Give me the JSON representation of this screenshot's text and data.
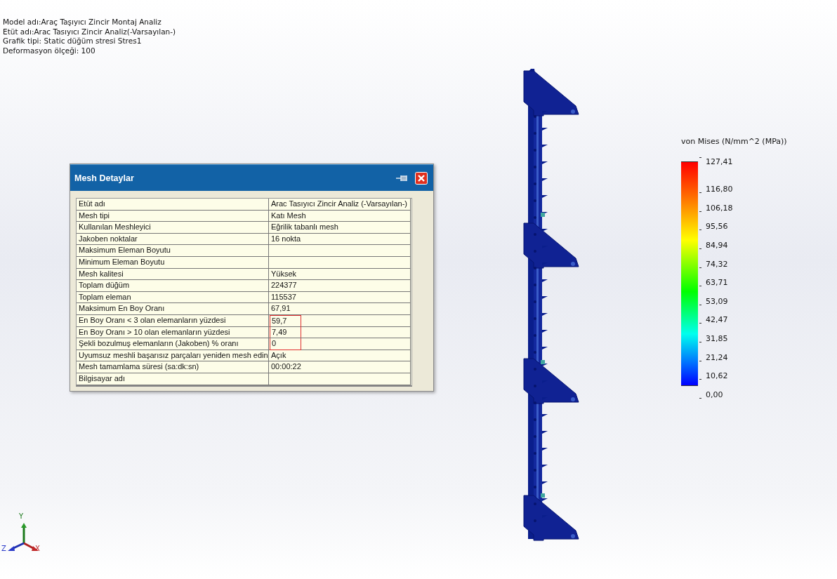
{
  "info_lines": [
    "Model adı:Araç Taşıyıcı Zincir Montaj Analiz",
    "Etüt adı:Arac Tasıyıcı Zincir Analiz(-Varsayılan-)",
    "Grafik tipi: Static düğüm stresi Stres1",
    "Deformasyon ölçeği: 100"
  ],
  "dialog": {
    "title": "Mesh Detaylar",
    "rows": [
      {
        "label": "Etüt adı",
        "value": "Arac Tasıyıcı Zincir Analiz (-Varsayılan-)",
        "highlighted": false
      },
      {
        "label": "Mesh tipi",
        "value": "Katı Mesh",
        "highlighted": false
      },
      {
        "label": "Kullanılan Meshleyici",
        "value": "Eğrilik tabanlı mesh",
        "highlighted": false
      },
      {
        "label": "Jakoben noktalar",
        "value": "16 nokta",
        "highlighted": false
      },
      {
        "label": "Maksimum Eleman Boyutu",
        "highlighted": false
      },
      {
        "label": "Minimum Eleman Boyutu",
        "highlighted": false
      },
      {
        "label": "Mesh kalitesi",
        "value": "Yüksek",
        "highlighted": false
      },
      {
        "label": "Toplam düğüm",
        "value": "224377",
        "highlighted": false
      },
      {
        "label": "Toplam eleman",
        "value": "115537",
        "highlighted": false
      },
      {
        "label": "Maksimum En Boy Oranı",
        "value": "67,91",
        "highlighted": false
      },
      {
        "label": "En Boy Oranı < 3 olan elemanların yüzdesi",
        "value": "59,7",
        "highlighted": true
      },
      {
        "label": "En Boy Oranı > 10 olan elemanların yüzdesi",
        "value": "7,49",
        "highlighted": true
      },
      {
        "label": "Şekli bozulmuş elemanların (Jakoben) % oranı",
        "value": "0",
        "highlighted": true
      },
      {
        "label": "Uyumsuz meshli başarısız parçaları yeniden mesh edin",
        "value": "Açık",
        "highlighted": false
      },
      {
        "label": "Mesh tamamlama süresi (sa:dk:sn)",
        "value": "00:00:22",
        "highlighted": false
      },
      {
        "label": "Bilgisayar adı",
        "highlighted": false
      }
    ]
  },
  "legend": {
    "title": "von Mises (N/mm^2 (MPa))",
    "labels": [
      "127,41",
      "116,80",
      "106,18",
      "95,56",
      "84,94",
      "74,32",
      "63,71",
      "53,09",
      "42,47",
      "31,85",
      "21,24",
      "10,62",
      "0,00"
    ]
  },
  "triad": {
    "y": "Y",
    "x": "X",
    "z": "Z"
  }
}
